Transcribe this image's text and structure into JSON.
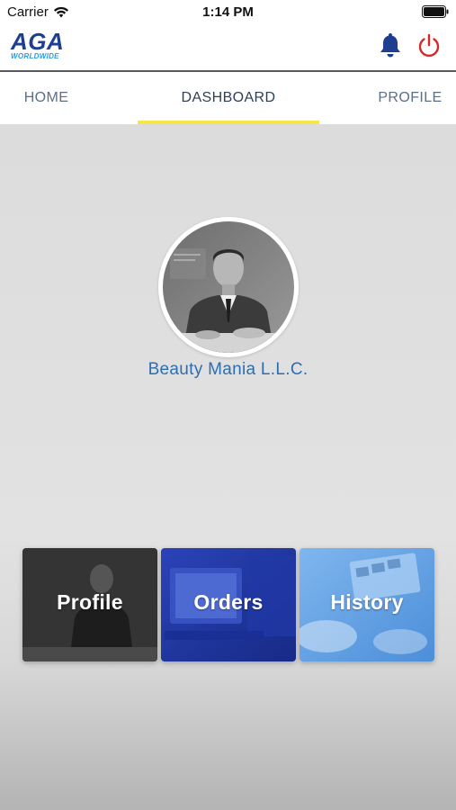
{
  "status_bar": {
    "carrier": "Carrier",
    "time": "1:14 PM"
  },
  "header": {
    "logo_main": "AGA",
    "logo_sub": "WORLDWIDE",
    "icons": [
      "bell-icon",
      "power-icon"
    ],
    "colors": {
      "logo_blue": "#1f3e8f",
      "logo_light": "#2a9be0",
      "bell": "#1f3e8f",
      "power": "#d62a2a"
    }
  },
  "tabs": [
    {
      "label": "HOME",
      "active": false
    },
    {
      "label": "DASHBOARD",
      "active": true
    },
    {
      "label": "PROFILE",
      "active": false
    }
  ],
  "tab_indicator_color": "#f4e64b",
  "profile": {
    "company_name": "Beauty Mania L.L.C."
  },
  "cards": [
    {
      "label": "Profile",
      "theme": "dark-gray"
    },
    {
      "label": "Orders",
      "theme": "blue"
    },
    {
      "label": "History",
      "theme": "light-blue"
    }
  ]
}
